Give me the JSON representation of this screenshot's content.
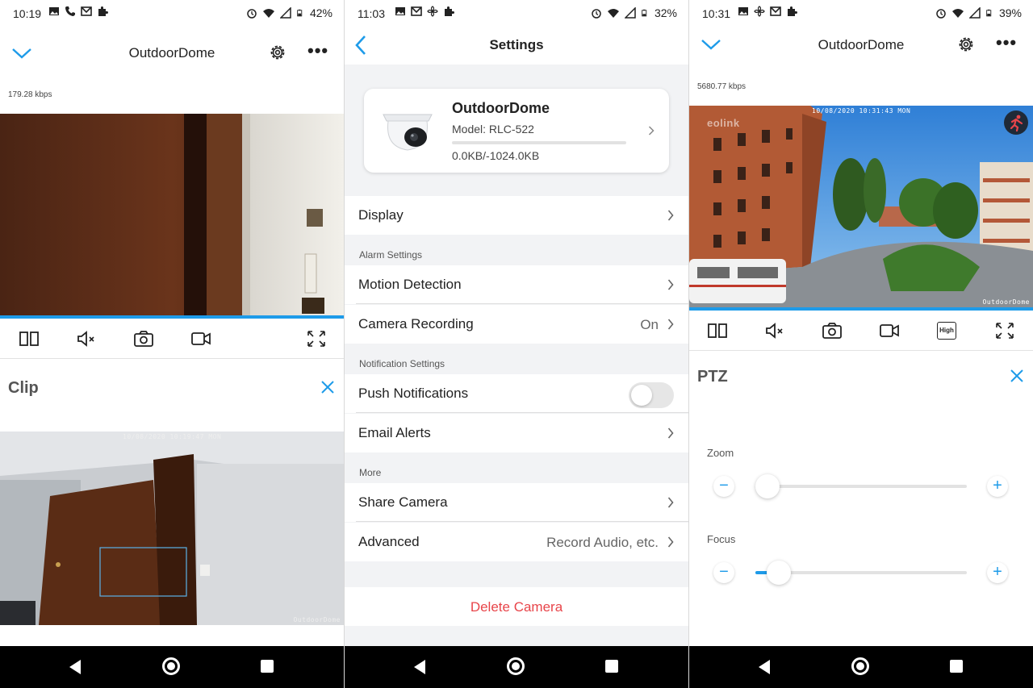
{
  "panel1": {
    "status": {
      "time": "10:19",
      "battery": "42%"
    },
    "title": "OutdoorDome",
    "bitrate": "179.28 kbps",
    "sheet_title": "Clip",
    "clip_osd_time": "10/08/2020 10:19:47 MON",
    "clip_osd_name": "OutdoorDome"
  },
  "panel2": {
    "status": {
      "time": "11:03",
      "battery": "32%"
    },
    "header_title": "Settings",
    "camera": {
      "name": "OutdoorDome",
      "model": "Model: RLC-522",
      "usage": "0.0KB/-1024.0KB"
    },
    "rows": {
      "display": "Display",
      "alarm_section": "Alarm Settings",
      "motion": "Motion Detection",
      "recording": "Camera Recording",
      "recording_value": "On",
      "notif_section": "Notification Settings",
      "push": "Push Notifications",
      "email": "Email Alerts",
      "more_section": "More",
      "share": "Share Camera",
      "advanced": "Advanced",
      "advanced_value": "Record Audio, etc.",
      "delete": "Delete Camera"
    }
  },
  "panel3": {
    "status": {
      "time": "10:31",
      "battery": "39%"
    },
    "title": "OutdoorDome",
    "bitrate": "5680.77 kbps",
    "osd_time": "10/08/2020 10:31:43 MON",
    "osd_name": "OutdoorDome",
    "osd_brand": "eolink",
    "quality_badge": "High",
    "sheet_title": "PTZ",
    "zoom_label": "Zoom",
    "focus_label": "Focus",
    "zoom_level": 0.0,
    "focus_level": 0.06
  },
  "colors": {
    "accent": "#1e9be9",
    "danger": "#e8454a",
    "motion_badge": "#e8454a"
  }
}
